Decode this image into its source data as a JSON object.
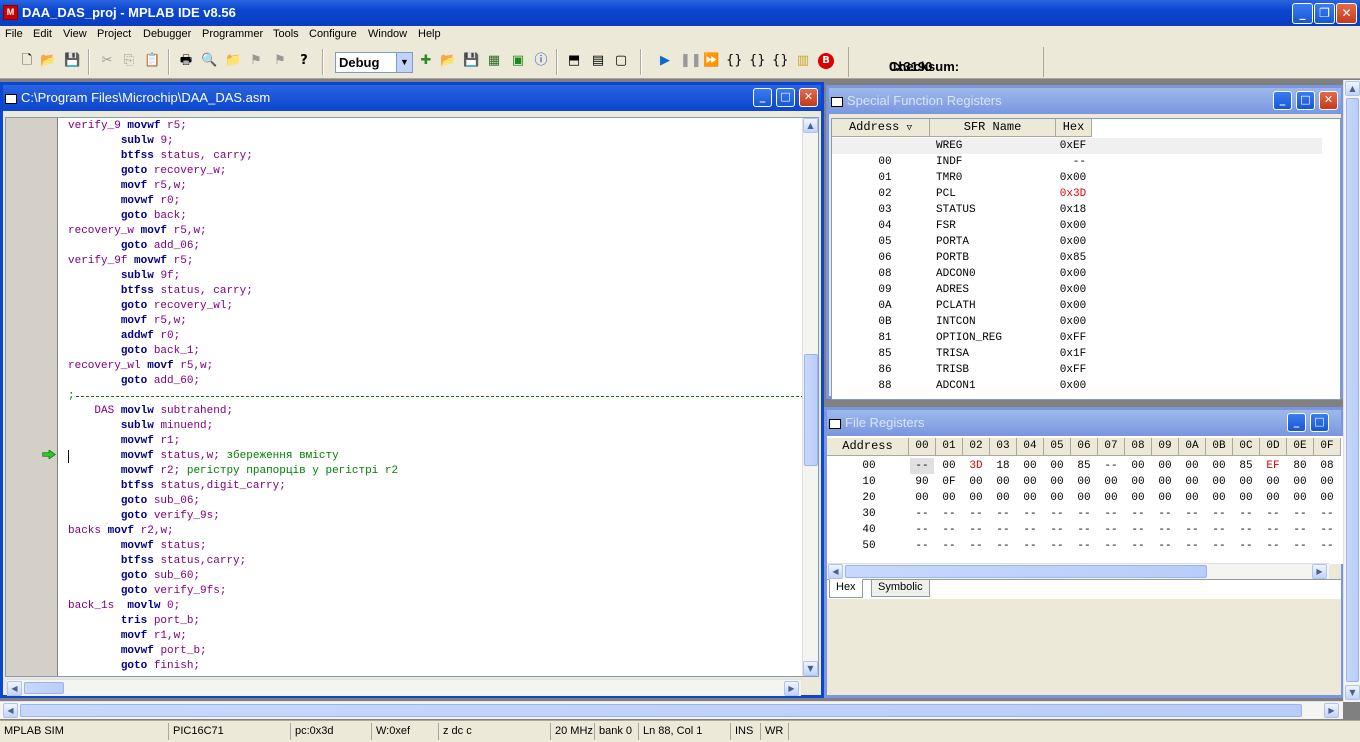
{
  "app": {
    "title": "DAA_DAS_proj - MPLAB IDE v8.56",
    "icon": "mplab-icon"
  },
  "menu": [
    "File",
    "Edit",
    "View",
    "Project",
    "Debugger",
    "Programmer",
    "Tools",
    "Configure",
    "Window",
    "Help"
  ],
  "toolbar": {
    "build_config": "Debug",
    "checksum_label": "Checksum:",
    "checksum_value": "0x3190"
  },
  "editor": {
    "title": "C:\\Program Files\\Microchip\\DAA_DAS.asm",
    "current_line_marker": "green-arrow-icon",
    "lines": [
      {
        "label": "verify_9",
        "op": "movwf",
        "args": "r5;"
      },
      {
        "label": "",
        "op": "sublw",
        "args": "9;"
      },
      {
        "label": "",
        "op": "btfss",
        "args": "status, carry;"
      },
      {
        "label": "",
        "op": "goto",
        "args": "recovery_w;"
      },
      {
        "label": "",
        "op": "movf",
        "args": "r5,w;"
      },
      {
        "label": "",
        "op": "movwf",
        "args": "r0;"
      },
      {
        "label": "",
        "op": "goto",
        "args": "back;"
      },
      {
        "label": "recovery_w",
        "op": "movf",
        "args": "r5,w;"
      },
      {
        "label": "",
        "op": "goto",
        "args": "add_06;"
      },
      {
        "label": "verify_9f",
        "op": "movwf",
        "args": "r5;"
      },
      {
        "label": "",
        "op": "sublw",
        "args": "9f;"
      },
      {
        "label": "",
        "op": "btfss",
        "args": "status, carry;"
      },
      {
        "label": "",
        "op": "goto",
        "args": "recovery_wl;"
      },
      {
        "label": "",
        "op": "movf",
        "args": "r5,w;"
      },
      {
        "label": "",
        "op": "addwf",
        "args": "r0;"
      },
      {
        "label": "",
        "op": "goto",
        "args": "back_1;"
      },
      {
        "label": "recovery_wl",
        "op": "movf",
        "args": "r5,w;"
      },
      {
        "label": "",
        "op": "goto",
        "args": "add_60;"
      },
      {
        "separator": ";"
      },
      {
        "label": "    DAS",
        "op": "movlw",
        "args": "subtrahend;"
      },
      {
        "label": "",
        "op": "sublw",
        "args": "minuend;"
      },
      {
        "label": "",
        "op": "movwf",
        "args": "r1;"
      },
      {
        "label": "",
        "op": "movwf",
        "args": "status,w;",
        "comment": " збереження вмісту"
      },
      {
        "label": "",
        "op": "movwf",
        "args": "r2;",
        "comment": " регістру прапорців у регістрі r2"
      },
      {
        "label": "",
        "op": "btfss",
        "args": "status,digit_carry;"
      },
      {
        "label": "",
        "op": "goto",
        "args": "sub_06;"
      },
      {
        "label": "",
        "op": "goto",
        "args": "verify_9s;"
      },
      {
        "label": "backs",
        "op": "movf",
        "args": "r2,w;"
      },
      {
        "label": "",
        "op": "movwf",
        "args": "status;"
      },
      {
        "label": "",
        "op": "btfss",
        "args": "status,carry;"
      },
      {
        "label": "",
        "op": "goto",
        "args": "sub_60;"
      },
      {
        "label": "",
        "op": "goto",
        "args": "verify_9fs;"
      },
      {
        "label": "back_1s ",
        "op": "movlw",
        "args": "0;"
      },
      {
        "label": "",
        "op": "tris",
        "args": "port_b;"
      },
      {
        "label": "",
        "op": "movf",
        "args": "r1,w;"
      },
      {
        "label": "",
        "op": "movwf",
        "args": "port_b;"
      },
      {
        "label": "",
        "op": "goto",
        "args": "finish;"
      }
    ]
  },
  "sfr": {
    "title": "Special Function Registers",
    "headers": [
      "Address",
      "SFR Name",
      "Hex"
    ],
    "rows": [
      {
        "addr": "",
        "name": "WREG",
        "hex": "0xEF",
        "changed": false
      },
      {
        "addr": "00",
        "name": "INDF",
        "hex": "--",
        "changed": false
      },
      {
        "addr": "01",
        "name": "TMR0",
        "hex": "0x00",
        "changed": false
      },
      {
        "addr": "02",
        "name": "PCL",
        "hex": "0x3D",
        "changed": true
      },
      {
        "addr": "03",
        "name": "STATUS",
        "hex": "0x18",
        "changed": false
      },
      {
        "addr": "04",
        "name": "FSR",
        "hex": "0x00",
        "changed": false
      },
      {
        "addr": "05",
        "name": "PORTA",
        "hex": "0x00",
        "changed": false
      },
      {
        "addr": "06",
        "name": "PORTB",
        "hex": "0x85",
        "changed": false
      },
      {
        "addr": "08",
        "name": "ADCON0",
        "hex": "0x00",
        "changed": false
      },
      {
        "addr": "09",
        "name": "ADRES",
        "hex": "0x00",
        "changed": false
      },
      {
        "addr": "0A",
        "name": "PCLATH",
        "hex": "0x00",
        "changed": false
      },
      {
        "addr": "0B",
        "name": "INTCON",
        "hex": "0x00",
        "changed": false
      },
      {
        "addr": "81",
        "name": "OPTION_REG",
        "hex": "0xFF",
        "changed": false
      },
      {
        "addr": "85",
        "name": "TRISA",
        "hex": "0x1F",
        "changed": false
      },
      {
        "addr": "86",
        "name": "TRISB",
        "hex": "0xFF",
        "changed": false
      },
      {
        "addr": "88",
        "name": "ADCON1",
        "hex": "0x00",
        "changed": false
      }
    ]
  },
  "filereg": {
    "title": "File Registers",
    "headers": [
      "Address",
      "00",
      "01",
      "02",
      "03",
      "04",
      "05",
      "06",
      "07",
      "08",
      "09",
      "0A",
      "0B",
      "0C",
      "0D",
      "0E",
      "0F"
    ],
    "rows": [
      {
        "addr": "00",
        "cells": [
          "--",
          "00",
          "3D",
          "18",
          "00",
          "00",
          "85",
          "--",
          "00",
          "00",
          "00",
          "00",
          "85",
          "EF",
          "80",
          "08"
        ],
        "red": [
          2,
          13
        ]
      },
      {
        "addr": "10",
        "cells": [
          "90",
          "0F",
          "00",
          "00",
          "00",
          "00",
          "00",
          "00",
          "00",
          "00",
          "00",
          "00",
          "00",
          "00",
          "00",
          "00"
        ],
        "red": []
      },
      {
        "addr": "20",
        "cells": [
          "00",
          "00",
          "00",
          "00",
          "00",
          "00",
          "00",
          "00",
          "00",
          "00",
          "00",
          "00",
          "00",
          "00",
          "00",
          "00"
        ],
        "red": []
      },
      {
        "addr": "30",
        "cells": [
          "--",
          "--",
          "--",
          "--",
          "--",
          "--",
          "--",
          "--",
          "--",
          "--",
          "--",
          "--",
          "--",
          "--",
          "--",
          "--"
        ],
        "red": []
      },
      {
        "addr": "40",
        "cells": [
          "--",
          "--",
          "--",
          "--",
          "--",
          "--",
          "--",
          "--",
          "--",
          "--",
          "--",
          "--",
          "--",
          "--",
          "--",
          "--"
        ],
        "red": []
      },
      {
        "addr": "50",
        "cells": [
          "--",
          "--",
          "--",
          "--",
          "--",
          "--",
          "--",
          "--",
          "--",
          "--",
          "--",
          "--",
          "--",
          "--",
          "--",
          "--"
        ],
        "red": []
      }
    ],
    "tabs": [
      "Hex",
      "Symbolic"
    ],
    "active_tab": "Hex"
  },
  "status": [
    "MPLAB SIM",
    "PIC16C71",
    "pc:0x3d",
    "W:0xef",
    "z dc c",
    "20 MHz",
    "bank 0",
    "Ln 88, Col 1",
    "INS",
    "WR"
  ]
}
